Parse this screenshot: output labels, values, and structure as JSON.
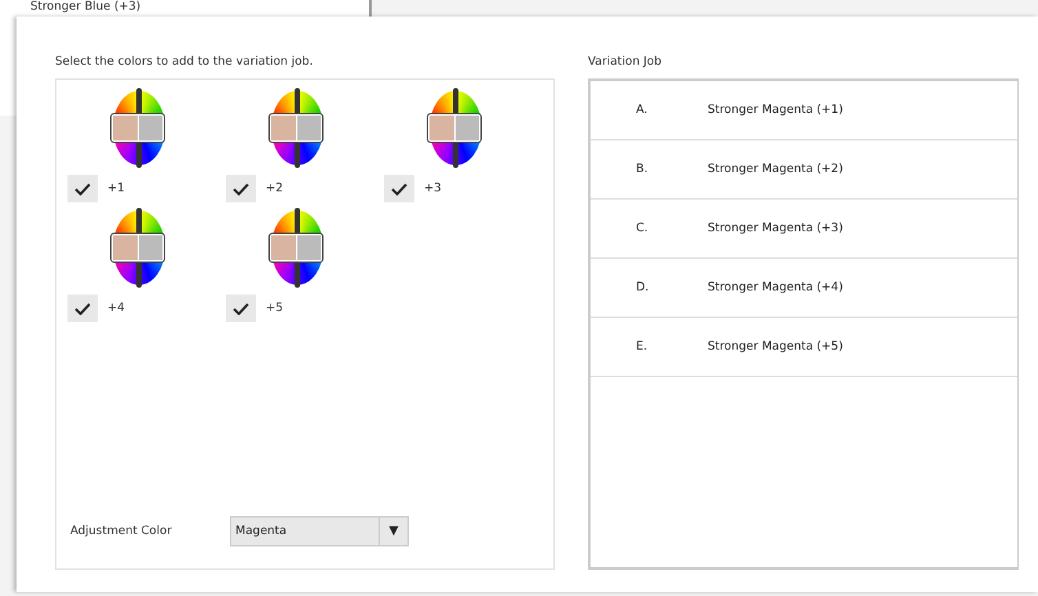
{
  "background_window": {
    "item_text": "Stronger Blue (+3)"
  },
  "dialog": {
    "instruction": "Select the colors to add to the variation job.",
    "variations": [
      {
        "label": "+1",
        "checked": true
      },
      {
        "label": "+2",
        "checked": true
      },
      {
        "label": "+3",
        "checked": true
      },
      {
        "label": "+4",
        "checked": true
      },
      {
        "label": "+5",
        "checked": true
      }
    ],
    "adjustment_color": {
      "label": "Adjustment Color",
      "value": "Magenta",
      "arrow": "▼"
    },
    "variation_job": {
      "title": "Variation Job",
      "items": [
        {
          "letter": "A.",
          "text": "Stronger Magenta (+1)"
        },
        {
          "letter": "B.",
          "text": "Stronger Magenta (+2)"
        },
        {
          "letter": "C.",
          "text": "Stronger Magenta (+3)"
        },
        {
          "letter": "D.",
          "text": "Stronger Magenta (+4)"
        },
        {
          "letter": "E.",
          "text": "Stronger Magenta (+5)"
        }
      ]
    }
  }
}
